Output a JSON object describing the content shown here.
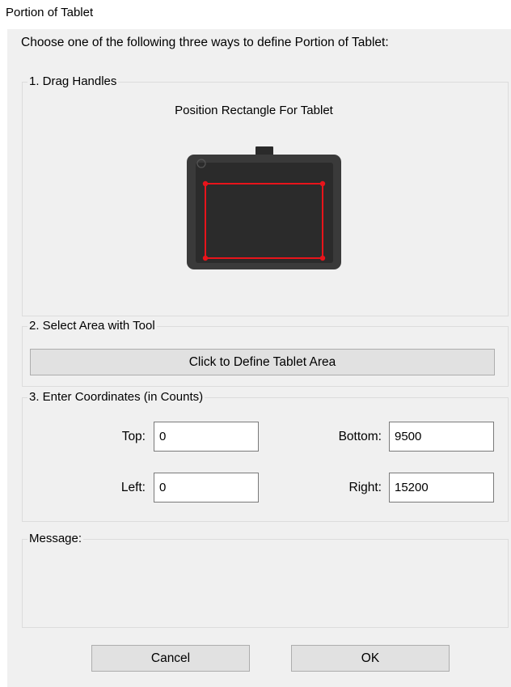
{
  "window": {
    "title": "Portion of Tablet"
  },
  "instructions": "Choose one of the following three ways to define Portion of Tablet:",
  "group_drag": {
    "legend": "1. Drag Handles",
    "subtitle": "Position Rectangle For Tablet",
    "colors": {
      "tablet_body": "#3a3a3a",
      "active_area": "#2b2b2b",
      "rectangle": "#e8141b"
    }
  },
  "group_select": {
    "legend": "2. Select Area with Tool",
    "button_label": "Click to Define Tablet Area"
  },
  "group_coords": {
    "legend": "3. Enter Coordinates (in Counts)",
    "top_label": "Top:",
    "top_value": "0",
    "bottom_label": "Bottom:",
    "bottom_value": "9500",
    "left_label": "Left:",
    "left_value": "0",
    "right_label": "Right:",
    "right_value": "15200"
  },
  "group_message": {
    "legend": "Message:",
    "text": ""
  },
  "buttons": {
    "cancel": "Cancel",
    "ok": "OK"
  }
}
